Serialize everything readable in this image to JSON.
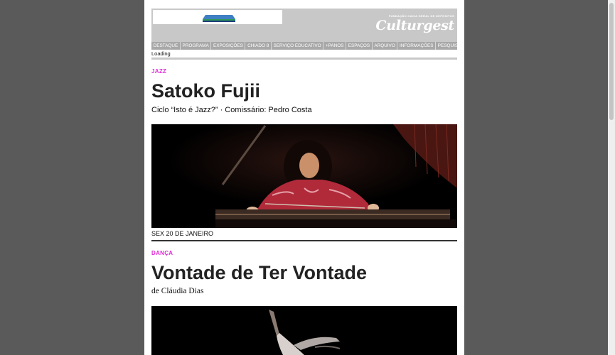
{
  "header": {
    "tagline": "FUNDAÇÃO CAIXA GERAL DE DEPÓSITOS",
    "brand": "Culturgest",
    "logo_colors": {
      "blue": "#3f7fc3",
      "green": "#2f9a5a",
      "navy": "#1d3e7a"
    }
  },
  "nav": {
    "items": [
      "DESTAQUE",
      "PROGRAMA",
      "EXPOSIÇÕES",
      "CHIADO 8",
      "SERVIÇO EDUCATIVO",
      "+PANOS",
      "ESPAÇOS",
      "ARQUIVO",
      "INFORMAÇÕES",
      "PESQUISAR"
    ]
  },
  "status": {
    "loading": "Loading"
  },
  "events": [
    {
      "category": "JAZZ",
      "title": "Satoko Fujii",
      "subtitle": "Ciclo “Isto é Jazz?” · Comissário: Pedro Costa",
      "date": "SEX 20 DE JANEIRO"
    },
    {
      "category": "DANÇA",
      "title": "Vontade de Ter Vontade",
      "subtitle": "de Cláudia Dias"
    }
  ],
  "colors": {
    "category": "#e02bd6",
    "page_bg": "#5a5a5a",
    "header_bg": "#c8c8c8",
    "nav_bg": "#a8a8a8"
  }
}
